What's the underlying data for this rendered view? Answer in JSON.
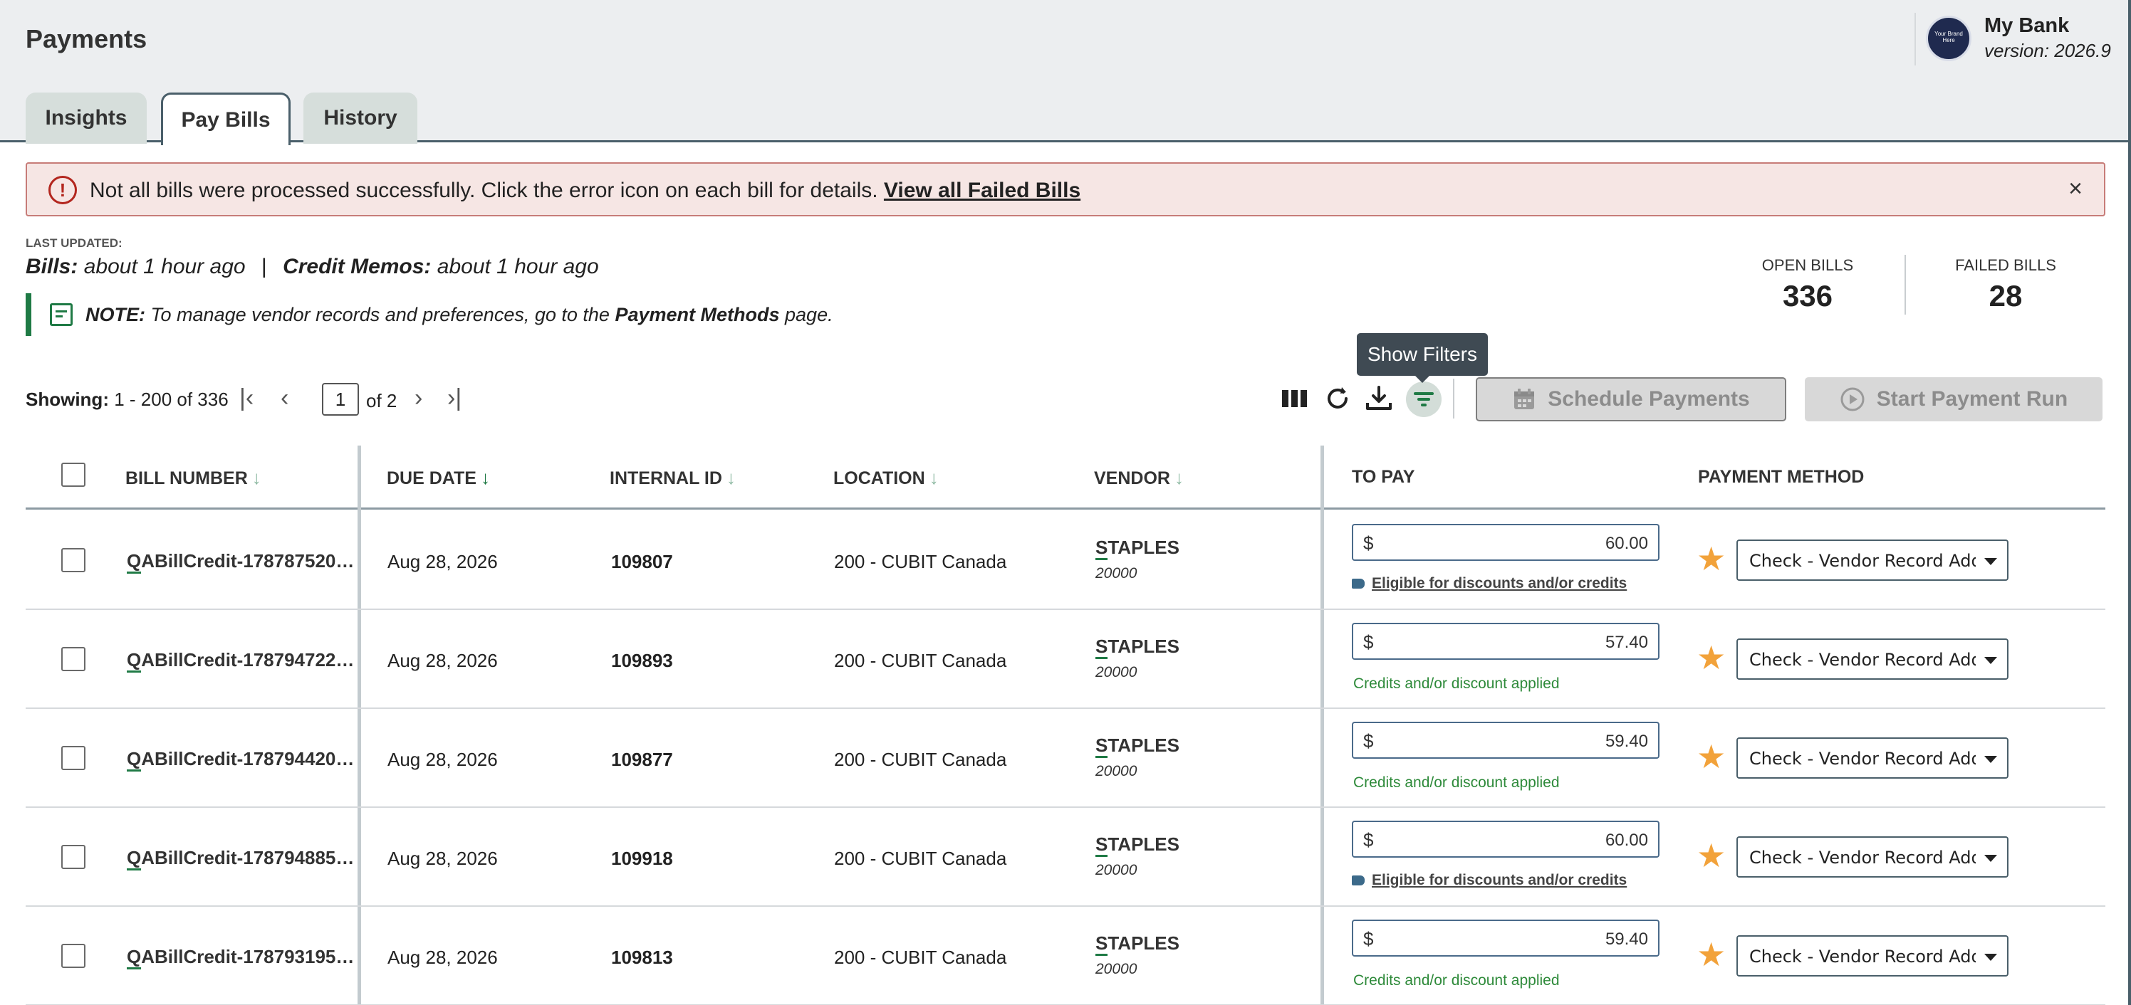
{
  "page": {
    "title": "Payments",
    "brand_logo_text": "Your Brand Here",
    "brand_name": "My Bank",
    "brand_version": "version: 2026.9"
  },
  "tabs": [
    {
      "label": "Insights",
      "active": false
    },
    {
      "label": "Pay Bills",
      "active": true
    },
    {
      "label": "History",
      "active": false
    }
  ],
  "error_banner": {
    "icon": "alert-circle-icon",
    "message": "Not all bills were processed successfully. Click the error icon on each bill for details.",
    "link": "View all Failed Bills",
    "close": "×"
  },
  "last_updated": {
    "label": "LAST UPDATED:",
    "bills_label": "Bills:",
    "bills_value": "about 1 hour ago",
    "separator": "|",
    "credit_label": "Credit Memos:",
    "credit_value": "about 1 hour ago"
  },
  "note": {
    "label": "NOTE:",
    "text_before": "To manage vendor records and preferences, go to the",
    "link": "Payment Methods",
    "text_after": "page."
  },
  "stats": {
    "open_label": "OPEN BILLS",
    "open_value": "336",
    "failed_label": "FAILED BILLS",
    "failed_value": "28"
  },
  "pager": {
    "showing_label": "Showing:",
    "showing_range": "1 - 200 of 336",
    "page": "1",
    "of": "of 2"
  },
  "toolbar": {
    "tooltip": "Show Filters",
    "schedule_label": "Schedule Payments",
    "start_run_label": "Start Payment Run"
  },
  "columns": {
    "bill_number": "BILL NUMBER",
    "due_date": "DUE DATE",
    "internal_id": "INTERNAL ID",
    "location": "LOCATION",
    "vendor": "VENDOR",
    "to_pay": "TO PAY",
    "payment_method": "PAYMENT METHOD"
  },
  "rows": [
    {
      "bill_first": "Q",
      "bill_rest": "ABillCredit-178787520…",
      "due": "Aug 28, 2026",
      "internal_id": "109807",
      "location": "200 - CUBIT Canada",
      "vendor_first": "S",
      "vendor_rest": "TAPLES",
      "vendor_code": "20000",
      "currency": "$",
      "amount": "60.00",
      "note": "Eligible for discounts and/or credits",
      "note_type": "eligible",
      "method": "Check - Vendor Record Address"
    },
    {
      "bill_first": "Q",
      "bill_rest": "ABillCredit-178794722…",
      "due": "Aug 28, 2026",
      "internal_id": "109893",
      "location": "200 - CUBIT Canada",
      "vendor_first": "S",
      "vendor_rest": "TAPLES",
      "vendor_code": "20000",
      "currency": "$",
      "amount": "57.40",
      "note": "Credits and/or discount applied",
      "note_type": "applied",
      "method": "Check - Vendor Record Address"
    },
    {
      "bill_first": "Q",
      "bill_rest": "ABillCredit-178794420…",
      "due": "Aug 28, 2026",
      "internal_id": "109877",
      "location": "200 - CUBIT Canada",
      "vendor_first": "S",
      "vendor_rest": "TAPLES",
      "vendor_code": "20000",
      "currency": "$",
      "amount": "59.40",
      "note": "Credits and/or discount applied",
      "note_type": "applied",
      "method": "Check - Vendor Record Address"
    },
    {
      "bill_first": "Q",
      "bill_rest": "ABillCredit-178794885…",
      "due": "Aug 28, 2026",
      "internal_id": "109918",
      "location": "200 - CUBIT Canada",
      "vendor_first": "S",
      "vendor_rest": "TAPLES",
      "vendor_code": "20000",
      "currency": "$",
      "amount": "60.00",
      "note": "Eligible for discounts and/or credits",
      "note_type": "eligible",
      "method": "Check - Vendor Record Address"
    },
    {
      "bill_first": "Q",
      "bill_rest": "ABillCredit-178793195…",
      "due": "Aug 28, 2026",
      "internal_id": "109813",
      "location": "200 - CUBIT Canada",
      "vendor_first": "S",
      "vendor_rest": "TAPLES",
      "vendor_code": "20000",
      "currency": "$",
      "amount": "59.40",
      "note": "Credits and/or discount applied",
      "note_type": "applied",
      "method": "Check - Vendor Record Address"
    }
  ],
  "colors": {
    "accent_green": "#1f7a45",
    "error_red": "#b3261e",
    "star_orange": "#f2a23a",
    "applied_green": "#2e8a3a"
  }
}
